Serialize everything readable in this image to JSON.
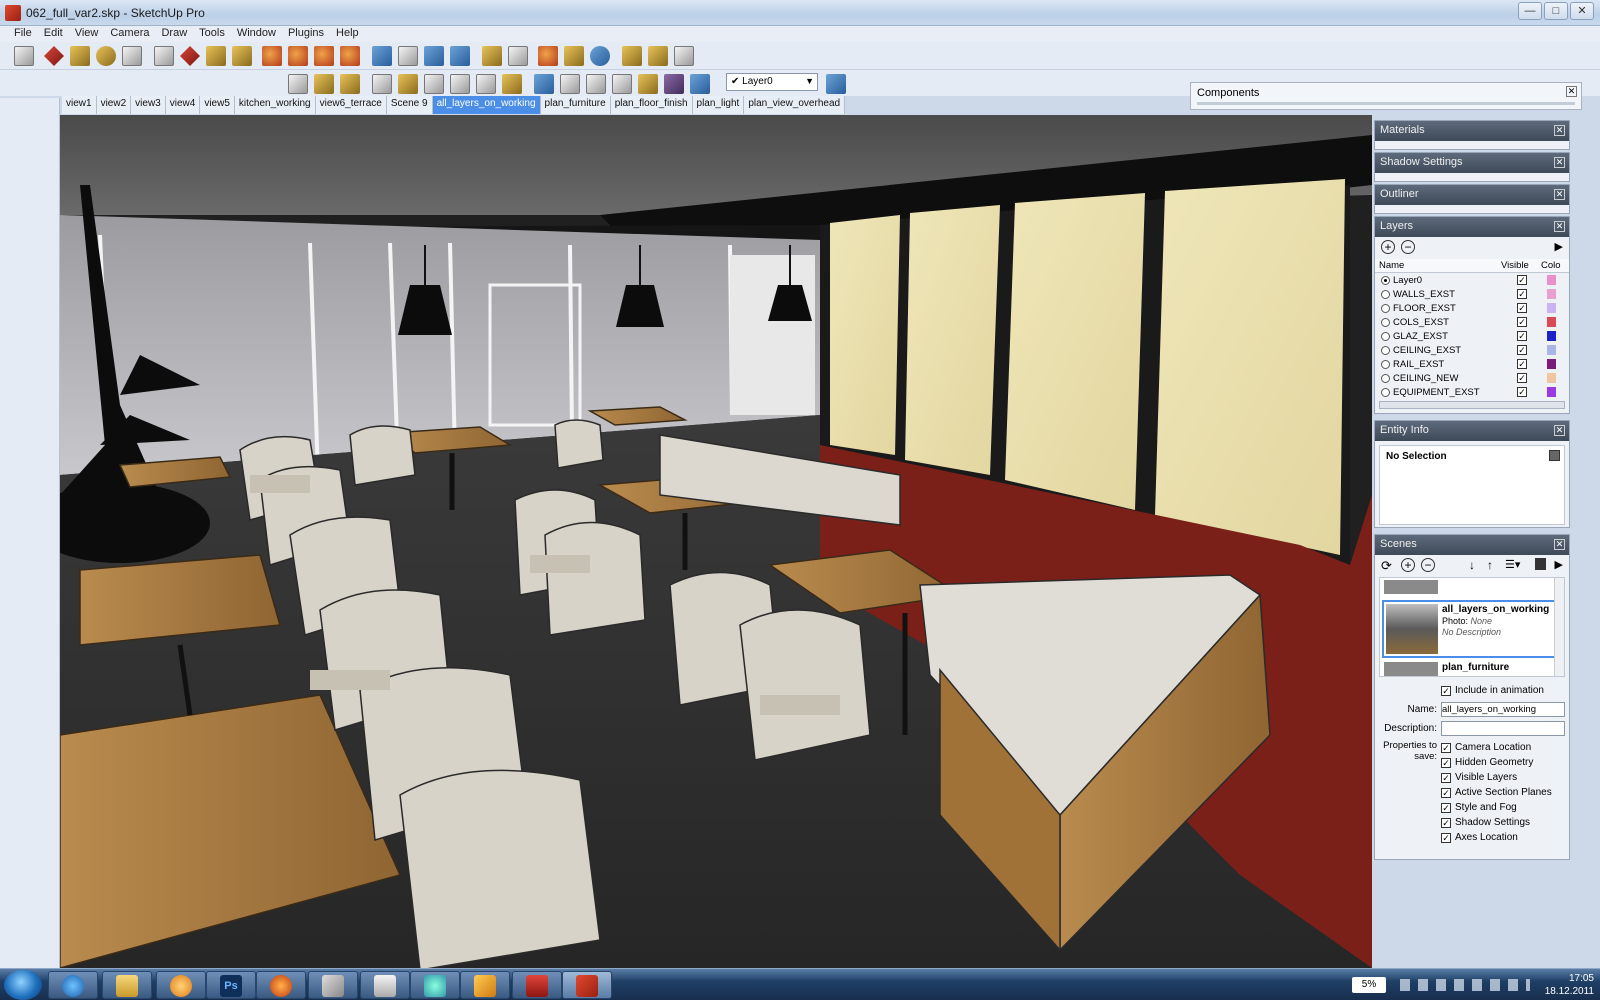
{
  "window": {
    "title": "062_full_var2.skp - SketchUp Pro",
    "controls": [
      "—",
      "□",
      "✕"
    ]
  },
  "menu": [
    "File",
    "Edit",
    "View",
    "Camera",
    "Draw",
    "Tools",
    "Window",
    "Plugins",
    "Help"
  ],
  "toolbar": {
    "layer_select": "Layer0"
  },
  "components": {
    "title": "Components",
    "close": "✕"
  },
  "scene_tabs": [
    {
      "label": "view1"
    },
    {
      "label": "view2"
    },
    {
      "label": "view3"
    },
    {
      "label": "view4"
    },
    {
      "label": "view5"
    },
    {
      "label": "kitchen_working"
    },
    {
      "label": "view6_terrace"
    },
    {
      "label": "Scene 9"
    },
    {
      "label": "all_layers_on_working",
      "active": true
    },
    {
      "label": "plan_furniture"
    },
    {
      "label": "plan_floor_finish"
    },
    {
      "label": "plan_light"
    },
    {
      "label": "plan_view_overhead"
    }
  ],
  "panels": {
    "materials": "Materials",
    "shadow_settings": "Shadow Settings",
    "outliner": "Outliner",
    "layers": {
      "title": "Layers",
      "col_name": "Name",
      "col_visible": "Visible",
      "col_color": "Colo",
      "rows": [
        {
          "name": "Layer0",
          "current": true,
          "color": "#e98fc9"
        },
        {
          "name": "WALLS_EXST",
          "current": false,
          "color": "#e8a0d0"
        },
        {
          "name": "FLOOR_EXST",
          "current": false,
          "color": "#c9b3f0"
        },
        {
          "name": "COLS_EXST",
          "current": false,
          "color": "#d94a52"
        },
        {
          "name": "GLAZ_EXST",
          "current": false,
          "color": "#1a22c8"
        },
        {
          "name": "CEILING_EXST",
          "current": false,
          "color": "#a9b6e8"
        },
        {
          "name": "RAIL_EXST",
          "current": false,
          "color": "#7a1a7a"
        },
        {
          "name": "CEILING_NEW",
          "current": false,
          "color": "#f0c6a0"
        },
        {
          "name": "EQUIPMENT_EXST",
          "current": false,
          "color": "#9a3ae0"
        }
      ]
    },
    "entity_info": {
      "title": "Entity Info",
      "selection": "No Selection"
    },
    "scenes": {
      "title": "Scenes",
      "selected_scene": "all_layers_on_working",
      "photo": "Photo:",
      "photo_value": "None",
      "description_text": "No Description",
      "next_scene": "plan_furniture",
      "include_animation": "Include in animation",
      "name_label": "Name:",
      "name_value": "all_layers_on_working",
      "description_label": "Description:",
      "properties_label": "Properties to save:",
      "properties": [
        "Camera Location",
        "Hidden Geometry",
        "Visible Layers",
        "Active Section Planes",
        "Style and Fog",
        "Shadow Settings",
        "Axes Location"
      ]
    }
  },
  "taskbar": {
    "battery": "5%",
    "time": "17:05",
    "date": "18.12.2011"
  }
}
